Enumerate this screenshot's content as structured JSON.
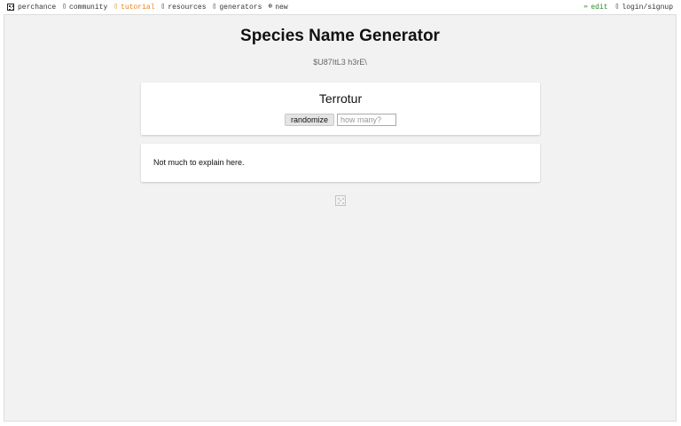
{
  "nav": {
    "brand": "perchance",
    "items": [
      {
        "label": "community",
        "icon": "chat-icon"
      },
      {
        "label": "tutorial",
        "icon": "book-icon"
      },
      {
        "label": "resources",
        "icon": "folder-icon"
      },
      {
        "label": "generators",
        "icon": "list-icon"
      },
      {
        "label": "new",
        "icon": "plus-circle-icon"
      }
    ],
    "right": {
      "edit": "edit",
      "login": "login/signup"
    }
  },
  "page": {
    "title": "Species Name Generator",
    "subtitle": "$U87ItL3 h3rE\\"
  },
  "generator": {
    "output": "Terrotur",
    "randomize_label": "randomize",
    "count_placeholder": "how many?"
  },
  "info": {
    "text": "Not much to explain here."
  },
  "colors": {
    "accent_tutorial": "#e8821c",
    "accent_edit": "#2a8a2a",
    "page_bg": "#f2f2f2"
  }
}
